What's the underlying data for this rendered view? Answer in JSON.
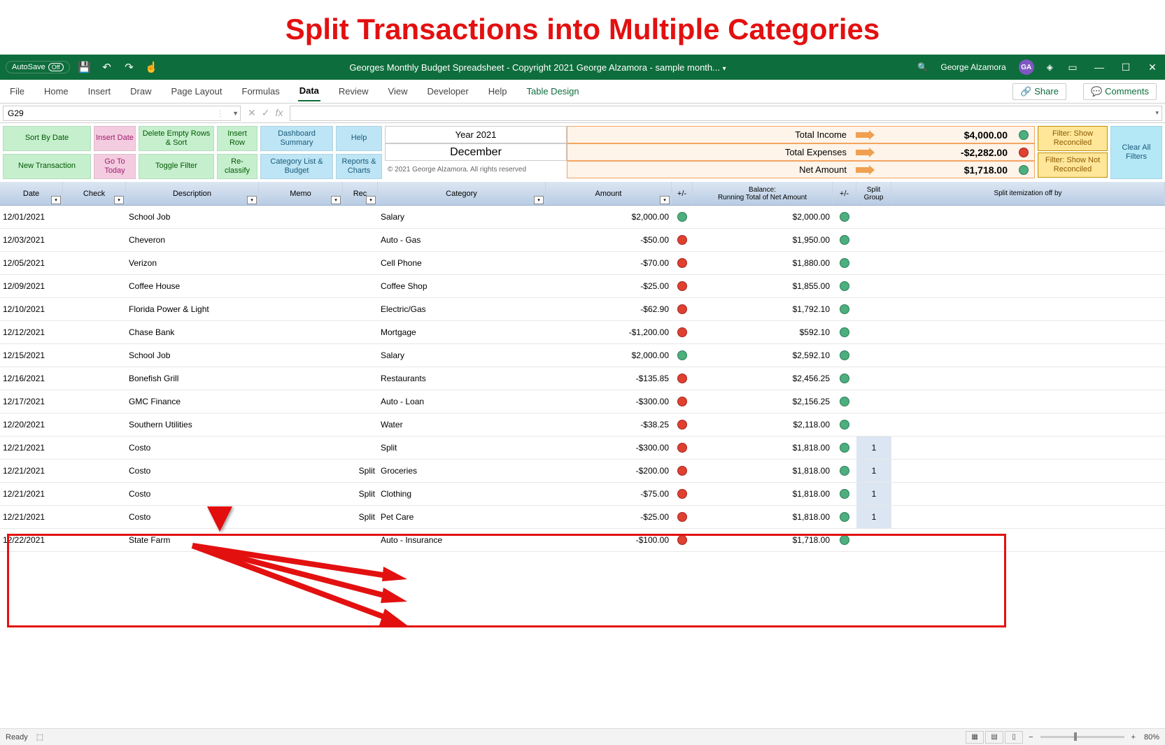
{
  "annotation": {
    "title": "Split Transactions into Multiple Categories"
  },
  "titlebar": {
    "autosave_label": "AutoSave",
    "autosave_state": "Off",
    "doc_title": "Georges Monthly Budget Spreadsheet - Copyright 2021 George Alzamora - sample month...",
    "user_name": "George Alzamora",
    "user_initials": "GA"
  },
  "ribbon": {
    "tabs": [
      "File",
      "Home",
      "Insert",
      "Draw",
      "Page Layout",
      "Formulas",
      "Data",
      "Review",
      "View",
      "Developer",
      "Help",
      "Table Design"
    ],
    "active_tab": "Data",
    "share": "Share",
    "comments": "Comments"
  },
  "formula": {
    "namebox": "G29"
  },
  "toolbar": {
    "c1": {
      "a": "Sort By Date",
      "b": "New Transaction"
    },
    "c2": {
      "a": "Insert Date",
      "b": "Go To Today"
    },
    "c3": {
      "a": "Delete Empty Rows & Sort",
      "b": "Toggle Filter"
    },
    "c4": {
      "a": "Insert Row",
      "b": "Re-classify"
    },
    "c5": {
      "a": "Dashboard Summary",
      "b": "Category List & Budget"
    },
    "c6": {
      "a": "Help",
      "b": "Reports & Charts"
    }
  },
  "summary": {
    "year": "Year 2021",
    "month": "December",
    "copyright": "© 2021 George Alzamora. All rights reserved",
    "rows": [
      {
        "label": "Total Income",
        "value": "$4,000.00",
        "dot": "green"
      },
      {
        "label": "Total Expenses",
        "value": "-$2,282.00",
        "dot": "red"
      },
      {
        "label": "Net Amount",
        "value": "$1,718.00",
        "dot": "green"
      }
    ]
  },
  "filters": {
    "show_reconciled": "Filter: Show Reconciled",
    "show_not_reconciled": "Filter: Show Not Reconciled",
    "clear_all": "Clear All Filters"
  },
  "grid": {
    "headers": {
      "date": "Date",
      "check": "Check",
      "description": "Description",
      "memo": "Memo",
      "rec": "Rec",
      "category": "Category",
      "amount": "Amount",
      "pm1": "+/-",
      "balance_line1": "Balance:",
      "balance_line2": "Running Total of Net Amount",
      "pm2": "+/-",
      "split_group": "Split Group",
      "split_item": "Split itemization off by"
    },
    "rows": [
      {
        "date": "12/01/2021",
        "desc": "School Job",
        "cat": "Salary",
        "amt": "$2,000.00",
        "dot1": "green",
        "bal": "$2,000.00",
        "dot2": "green"
      },
      {
        "date": "12/03/2021",
        "desc": "Cheveron",
        "cat": "Auto - Gas",
        "amt": "-$50.00",
        "dot1": "red",
        "bal": "$1,950.00",
        "dot2": "green"
      },
      {
        "date": "12/05/2021",
        "desc": "Verizon",
        "cat": "Cell Phone",
        "amt": "-$70.00",
        "dot1": "red",
        "bal": "$1,880.00",
        "dot2": "green"
      },
      {
        "date": "12/09/2021",
        "desc": "Coffee House",
        "cat": "Coffee Shop",
        "amt": "-$25.00",
        "dot1": "red",
        "bal": "$1,855.00",
        "dot2": "green"
      },
      {
        "date": "12/10/2021",
        "desc": "Florida Power & Light",
        "cat": "Electric/Gas",
        "amt": "-$62.90",
        "dot1": "red",
        "bal": "$1,792.10",
        "dot2": "green"
      },
      {
        "date": "12/12/2021",
        "desc": "Chase Bank",
        "cat": "Mortgage",
        "amt": "-$1,200.00",
        "dot1": "red",
        "bal": "$592.10",
        "dot2": "green"
      },
      {
        "date": "12/15/2021",
        "desc": "School Job",
        "cat": "Salary",
        "amt": "$2,000.00",
        "dot1": "green",
        "bal": "$2,592.10",
        "dot2": "green"
      },
      {
        "date": "12/16/2021",
        "desc": "Bonefish Grill",
        "cat": "Restaurants",
        "amt": "-$135.85",
        "dot1": "red",
        "bal": "$2,456.25",
        "dot2": "green"
      },
      {
        "date": "12/17/2021",
        "desc": "GMC Finance",
        "cat": "Auto - Loan",
        "amt": "-$300.00",
        "dot1": "red",
        "bal": "$2,156.25",
        "dot2": "green"
      },
      {
        "date": "12/20/2021",
        "desc": "Southern Utilities",
        "cat": "Water",
        "amt": "-$38.25",
        "dot1": "red",
        "bal": "$2,118.00",
        "dot2": "green"
      },
      {
        "date": "12/21/2021",
        "desc": "Costo",
        "cat": "Split",
        "amt": "-$300.00",
        "dot1": "red",
        "bal": "$1,818.00",
        "dot2": "green",
        "sg": "1"
      },
      {
        "date": "12/21/2021",
        "desc": "Costo",
        "rec": "Split",
        "cat": "Groceries",
        "amt": "-$200.00",
        "dot1": "red",
        "bal": "$1,818.00",
        "dot2": "green",
        "sg": "1"
      },
      {
        "date": "12/21/2021",
        "desc": "Costo",
        "rec": "Split",
        "cat": "Clothing",
        "amt": "-$75.00",
        "dot1": "red",
        "bal": "$1,818.00",
        "dot2": "green",
        "sg": "1"
      },
      {
        "date": "12/21/2021",
        "desc": "Costo",
        "rec": "Split",
        "cat": "Pet Care",
        "amt": "-$25.00",
        "dot1": "red",
        "bal": "$1,818.00",
        "dot2": "green",
        "sg": "1"
      },
      {
        "date": "12/22/2021",
        "desc": "State Farm",
        "cat": "Auto - Insurance",
        "amt": "-$100.00",
        "dot1": "red",
        "bal": "$1,718.00",
        "dot2": "green"
      }
    ]
  },
  "statusbar": {
    "ready": "Ready",
    "zoom": "80%"
  }
}
